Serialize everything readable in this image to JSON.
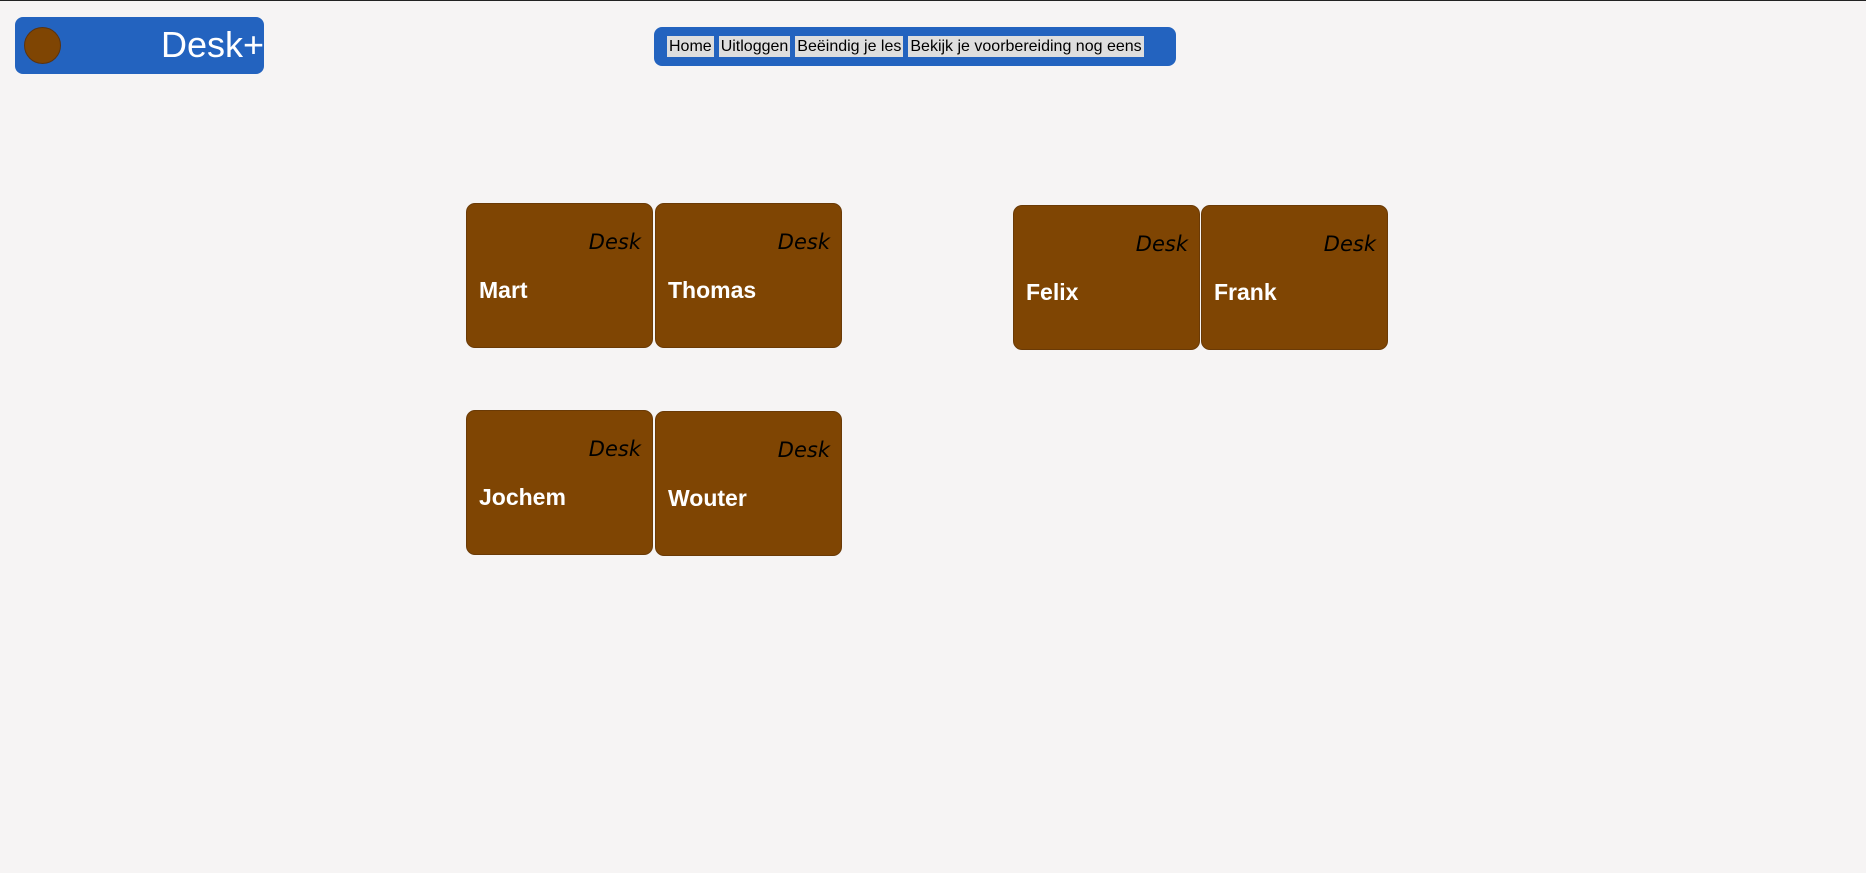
{
  "header": {
    "logo_text": "Desk+"
  },
  "nav": {
    "items": [
      {
        "label": "Home"
      },
      {
        "label": "Uitloggen"
      },
      {
        "label": "Beëindig je les"
      },
      {
        "label": "Bekijk je voorbereiding nog eens"
      }
    ]
  },
  "desks": [
    {
      "label": "Desk",
      "name": "Mart"
    },
    {
      "label": "Desk",
      "name": "Thomas"
    },
    {
      "label": "Desk",
      "name": "Felix"
    },
    {
      "label": "Desk",
      "name": "Frank"
    },
    {
      "label": "Desk",
      "name": "Jochem"
    },
    {
      "label": "Desk",
      "name": "Wouter"
    }
  ],
  "colors": {
    "brand_blue": "#2363bf",
    "desk_brown": "#7f4503",
    "background": "#f6f4f4"
  }
}
